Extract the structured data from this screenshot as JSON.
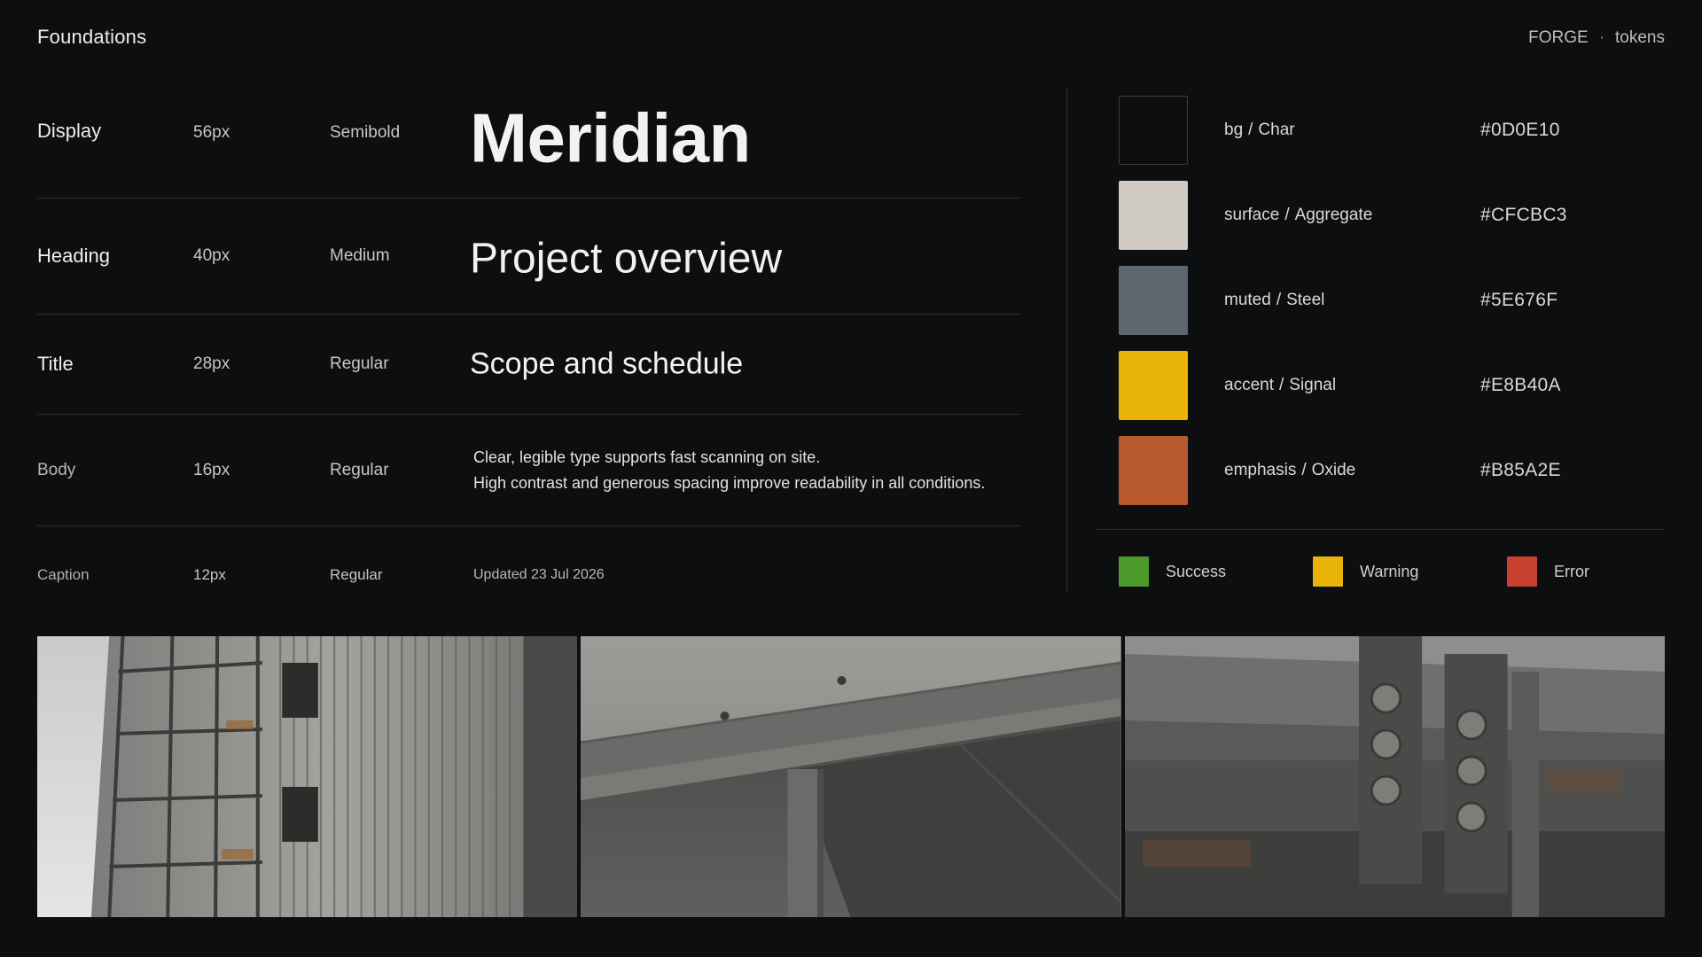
{
  "header": {
    "title": "Foundations",
    "brand": "FORGE",
    "separator": "·",
    "section": "tokens"
  },
  "type_scale": [
    {
      "name": "Display",
      "size": "56px",
      "weight": "Semibold",
      "sample": "Meridian"
    },
    {
      "name": "Heading",
      "size": "40px",
      "weight": "Medium",
      "sample": "Project overview"
    },
    {
      "name": "Title",
      "size": "28px",
      "weight": "Regular",
      "sample": "Scope and schedule"
    },
    {
      "name": "Body",
      "size": "16px",
      "weight": "Regular",
      "sample_lines": [
        "Clear, legible type supports fast scanning on site.",
        "High contrast and generous spacing improve readability in all conditions."
      ]
    },
    {
      "name": "Caption",
      "size": "12px",
      "weight": "Regular",
      "sample": "Updated 23 Jul 2026"
    }
  ],
  "palette": [
    {
      "role": "bg",
      "name": "Char",
      "hex": "#0D0E10"
    },
    {
      "role": "surface",
      "name": "Aggregate",
      "hex": "#CFCBC3"
    },
    {
      "role": "muted",
      "name": "Steel",
      "hex": "#5E676F"
    },
    {
      "role": "accent",
      "name": "Signal",
      "hex": "#E8B40A"
    },
    {
      "role": "emphasis",
      "name": "Oxide",
      "hex": "#B85A2E"
    }
  ],
  "palette_separator": "/",
  "status": [
    {
      "label": "Success",
      "color": "#4C9A2A"
    },
    {
      "label": "Warning",
      "color": "#E8B40A"
    },
    {
      "label": "Error",
      "color": "#C8402E"
    }
  ],
  "photos": [
    {
      "subject": "concrete building facade with scaffolding"
    },
    {
      "subject": "concrete beam and column underside"
    },
    {
      "subject": "bolted steel connection plates"
    }
  ]
}
